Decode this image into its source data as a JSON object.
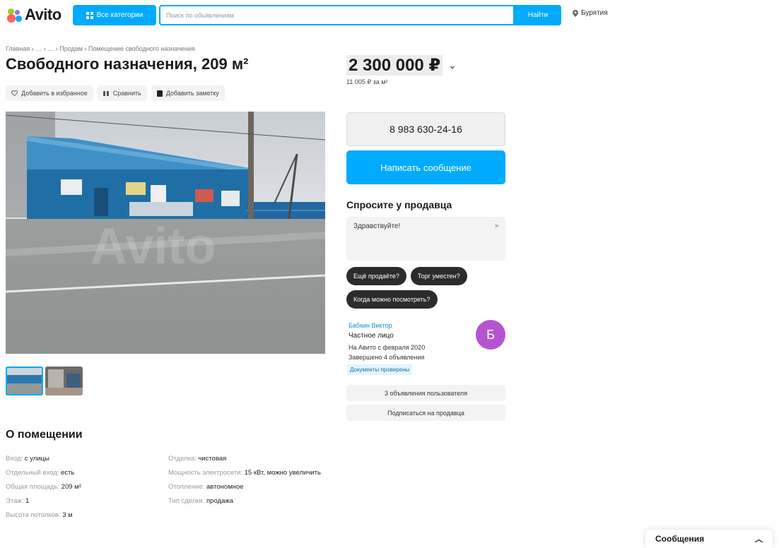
{
  "header": {
    "logo": "Avito",
    "categories_label": "Все категории",
    "search_placeholder": "Поиск по объявлениям",
    "find_label": "Найти",
    "region": "Бурятия"
  },
  "breadcrumb": "Главная › … › … › Продам › Помещение свободного назначения",
  "listing": {
    "title": "Свободного назначения, 209 м²",
    "actions": [
      {
        "icon": "heart-icon",
        "label": "Добавить в избранное"
      },
      {
        "icon": "compare-icon",
        "label": "Сравнить"
      },
      {
        "icon": "note-icon",
        "label": "Добавить заметку"
      }
    ],
    "price": "2 300 000 ₽",
    "price_per_m": "11 005 ₽ за м²",
    "watermark": "Avito"
  },
  "contact": {
    "phone": "8 983 630-24-16",
    "message_button": "Написать сообщение",
    "ask_title": "Спросите у продавца",
    "ask_text": "Здравствуйте!",
    "chips": [
      "Ещё продаёте?",
      "Торг уместен?",
      "Когда можно посмотреть?"
    ]
  },
  "seller": {
    "name": "Бабкин Виктор",
    "type": "Частное лицо",
    "since": "На Авито с февраля 2020",
    "completed": "Завершено 4 объявления",
    "docs": "Документы проверены",
    "avatar_letter": "Б",
    "avatar_color": "#b554d0",
    "links": [
      "3 объявления пользователя",
      "Подписаться на продавца"
    ]
  },
  "about": {
    "title": "О помещении",
    "left": [
      {
        "k": "Вход:",
        "v": "с улицы"
      },
      {
        "k": "Отдельный вход:",
        "v": "есть"
      },
      {
        "k": "Общая площадь:",
        "v": "209 м²"
      },
      {
        "k": "Этаж:",
        "v": "1"
      },
      {
        "k": "Высота потолков:",
        "v": "3 м"
      }
    ],
    "right": [
      {
        "k": "Отделка:",
        "v": "чистовая"
      },
      {
        "k": "Мощность электросети:",
        "v": "15 кВт, можно увеличить"
      },
      {
        "k": "Отопление:",
        "v": "автономное"
      },
      {
        "k": "Тип сделки:",
        "v": "продажа"
      }
    ]
  },
  "messages": {
    "label": "Сообщения"
  },
  "colors": {
    "accent": "#00aaff",
    "chip": "#2c2c2c"
  }
}
